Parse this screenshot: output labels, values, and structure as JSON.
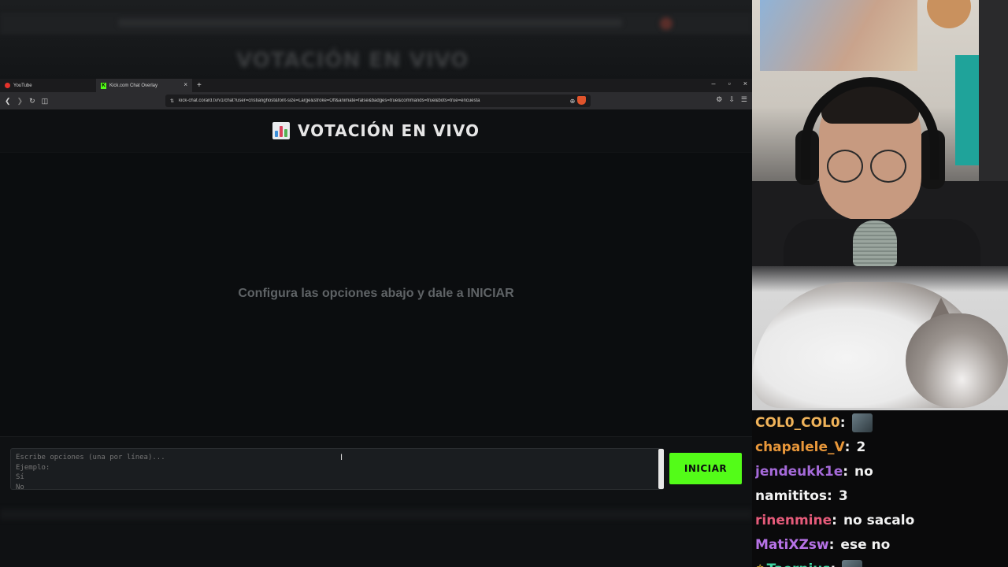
{
  "browser": {
    "tabs": [
      {
        "label": "YouTube",
        "icon": "youtube-icon"
      },
      {
        "label": "Kick.com Chat Overlay",
        "icon": "kick-icon",
        "close": "×"
      }
    ],
    "new_tab": "+",
    "window_controls": {
      "minimize": "–",
      "maximize": "▫",
      "close": "×"
    },
    "url": "kick-chat.corard.tv/v1/chat?user=cristianghost&font-size=Large&stroke=Off&animate=false&badges=true&commands=true&bots=true=encuesta"
  },
  "page": {
    "title": "VOTACIÓN EN VIVO",
    "empty_message": "Configura las opciones abajo y dale a INICIAR",
    "options_placeholder": "Escribe opciones (una por línea)...\nEjemplo:\nSí\nNo",
    "start_label": "INICIAR",
    "accent_color": "#53fc18"
  },
  "chat": {
    "messages": [
      {
        "user": "COL0_COL0",
        "color": "#f0b35a",
        "text": "",
        "emote": true
      },
      {
        "user": "chapalele_V",
        "color": "#e8973a",
        "text": "2"
      },
      {
        "user": "jendeukk1e",
        "color": "#a56ad9",
        "text": "no"
      },
      {
        "user": "namititos",
        "color": "#f2f2f2",
        "text": "3"
      },
      {
        "user": "rinenmine",
        "color": "#e55b7a",
        "text": "no sacalo"
      },
      {
        "user": "MatiXZsw",
        "color": "#b672e6",
        "text": "ese no"
      },
      {
        "user": "Taernius",
        "color": "#3fd6a2",
        "text": "",
        "emote": true,
        "crown": true
      }
    ]
  }
}
